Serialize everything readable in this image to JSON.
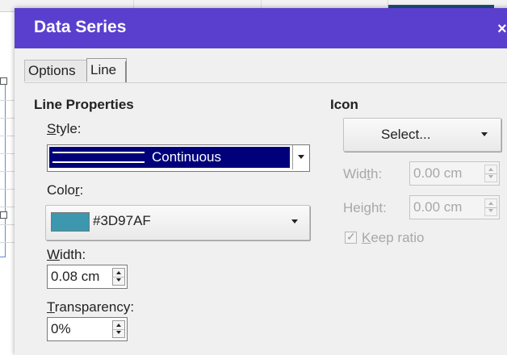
{
  "dialog": {
    "title": "Data Series",
    "close_icon": "close-icon"
  },
  "tabs": [
    {
      "label": "Options",
      "active": false
    },
    {
      "label": "Line",
      "active": true
    }
  ],
  "line_properties": {
    "section_title": "Line Properties",
    "style_label": "Style:",
    "style_value": "Continuous",
    "color_label": "Color:",
    "color_value": "#3D97AF",
    "color_swatch": "#3D97AF",
    "width_label": "Width:",
    "width_value": "0.08 cm",
    "transparency_label": "Transparency:",
    "transparency_value": "0%"
  },
  "icon": {
    "section_title": "Icon",
    "select_label": "Select...",
    "width_label": "Width:",
    "width_value": "0.00 cm",
    "height_label": "Height:",
    "height_value": "0.00 cm",
    "keep_ratio_label": "Keep ratio",
    "keep_ratio_checked": true,
    "disabled": true
  },
  "colors": {
    "titlebar": "#5a3fcf",
    "selection": "#00007b",
    "swatch": "#3D97AF"
  }
}
